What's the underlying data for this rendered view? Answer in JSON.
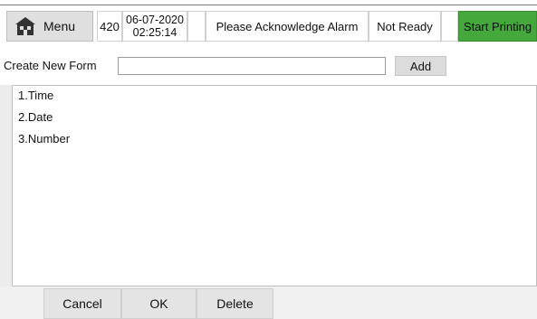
{
  "topbar": {
    "menu_label": "Menu",
    "menu_icon": "home-icon",
    "count": "420",
    "date": "06-07-2020",
    "time": "02:25:14",
    "alarm_text": "Please Acknowledge Alarm",
    "status_text": "Not Ready",
    "start_label": "Start Printing",
    "start_color": "#45a83c"
  },
  "form": {
    "label": "Create New Form",
    "input_value": "",
    "add_label": "Add"
  },
  "list": {
    "items": [
      "1.Time",
      "2.Date",
      "3.Number"
    ]
  },
  "bottom": {
    "cancel_label": "Cancel",
    "ok_label": "OK",
    "delete_label": "Delete"
  }
}
